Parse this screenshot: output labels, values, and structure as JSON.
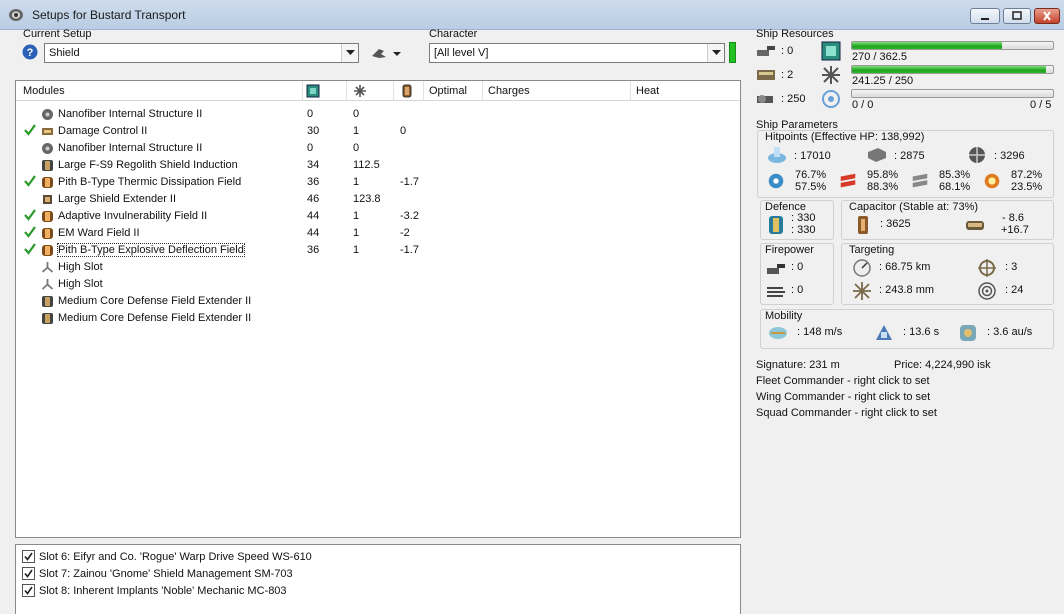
{
  "window": {
    "title": "Setups for Bustard Transport"
  },
  "setup": {
    "label": "Current Setup",
    "value": "Shield"
  },
  "character": {
    "label": "Character",
    "value": "[All level V]"
  },
  "modules": {
    "headers": {
      "name": "Modules",
      "optimal": "Optimal",
      "charges": "Charges",
      "heat": "Heat"
    },
    "rows": [
      {
        "checked": false,
        "icon": "structure-icon",
        "name": "Nanofiber Internal Structure II",
        "c1": "0",
        "c2": "0",
        "c3": ""
      },
      {
        "checked": true,
        "icon": "damage-control-icon",
        "name": "Damage Control II",
        "c1": "30",
        "c2": "1",
        "c3": "0"
      },
      {
        "checked": false,
        "icon": "structure-icon",
        "name": "Nanofiber Internal Structure II",
        "c1": "0",
        "c2": "0",
        "c3": ""
      },
      {
        "checked": false,
        "icon": "rig-icon",
        "name": "Large F-S9 Regolith Shield Induction",
        "c1": "34",
        "c2": "112.5",
        "c3": ""
      },
      {
        "checked": true,
        "icon": "shield-hardener-icon",
        "name": "Pith B-Type Thermic Dissipation Field",
        "c1": "36",
        "c2": "1",
        "c3": "-1.7"
      },
      {
        "checked": false,
        "icon": "shield-extender-icon",
        "name": "Large Shield Extender II",
        "c1": "46",
        "c2": "123.8",
        "c3": ""
      },
      {
        "checked": true,
        "icon": "shield-hardener-icon",
        "name": "Adaptive Invulnerability Field II",
        "c1": "44",
        "c2": "1",
        "c3": "-3.2"
      },
      {
        "checked": true,
        "icon": "shield-hardener-icon",
        "name": "EM Ward Field II",
        "c1": "44",
        "c2": "1",
        "c3": "-2"
      },
      {
        "checked": true,
        "icon": "shield-hardener-icon",
        "name": "Pith B-Type Explosive Deflection Field",
        "c1": "36",
        "c2": "1",
        "c3": "-1.7"
      },
      {
        "checked": false,
        "icon": "high-slot-icon",
        "name": "High Slot",
        "c1": "",
        "c2": "",
        "c3": ""
      },
      {
        "checked": false,
        "icon": "high-slot-icon",
        "name": "High Slot",
        "c1": "",
        "c2": "",
        "c3": ""
      },
      {
        "checked": false,
        "icon": "rig-icon",
        "name": "Medium Core Defense Field Extender II",
        "c1": "",
        "c2": "",
        "c3": ""
      },
      {
        "checked": false,
        "icon": "rig-icon",
        "name": "Medium Core Defense Field Extender II",
        "c1": "",
        "c2": "",
        "c3": ""
      }
    ]
  },
  "implants": [
    "Slot 6: Eifyr and Co. 'Rogue' Warp Drive Speed WS-610",
    "Slot 7: Zainou 'Gnome' Shield Management SM-703",
    "Slot 8: Inherent Implants 'Noble' Mechanic MC-803"
  ],
  "resources": {
    "title": "Ship Resources",
    "turrets": ": 0",
    "launchers": ": 2",
    "drone_bay": ": 250",
    "cpu": {
      "text": "270 / 362.5",
      "fraction": 0.745
    },
    "powergrid": {
      "text": "241.25 / 250",
      "fraction": 0.965
    },
    "calibration": {
      "text": "0 / 0",
      "right": "0 / 5",
      "fraction": 0.0
    }
  },
  "params": {
    "title": "Ship Parameters",
    "hitpoints": {
      "label": "Hitpoints (Effective HP: 138,992)",
      "shield": ": 17010",
      "armor": ": 2875",
      "structure": ": 3296",
      "em": [
        "76.7%",
        "57.5%"
      ],
      "thermal": [
        "95.8%",
        "88.3%"
      ],
      "kinetic": [
        "85.3%",
        "68.1%"
      ],
      "explosive": [
        "87.2%",
        "23.5%"
      ]
    },
    "defence": {
      "label": "Defence",
      "v1": ": 330",
      "v2": ": 330"
    },
    "capacitor": {
      "label": "Capacitor (Stable at: 73%)",
      "capacity": ": 3625",
      "delta1": "- 8.6",
      "delta2": "+16.7"
    },
    "firepower": {
      "label": "Firepower",
      "turret": ": 0",
      "missile": ": 0"
    },
    "targeting": {
      "label": "Targeting",
      "range": ": 68.75 km",
      "targets": ": 3",
      "resolution": ": 243.8 mm",
      "sensor": ": 24"
    },
    "mobility": {
      "label": "Mobility",
      "speed": ": 148 m/s",
      "align": ": 13.6 s",
      "warp": ": 3.6 au/s"
    }
  },
  "info": {
    "signature": "Signature: 231 m",
    "price": "Price: 4,224,990 isk",
    "fleet": "Fleet Commander - right click to set",
    "wing": "Wing Commander - right click to set",
    "squad": "Squad Commander - right click to set"
  },
  "colors": {
    "bar_green": "#2fb52b",
    "check_green": "#2a9a2a",
    "indicator_green": "#22c022"
  }
}
